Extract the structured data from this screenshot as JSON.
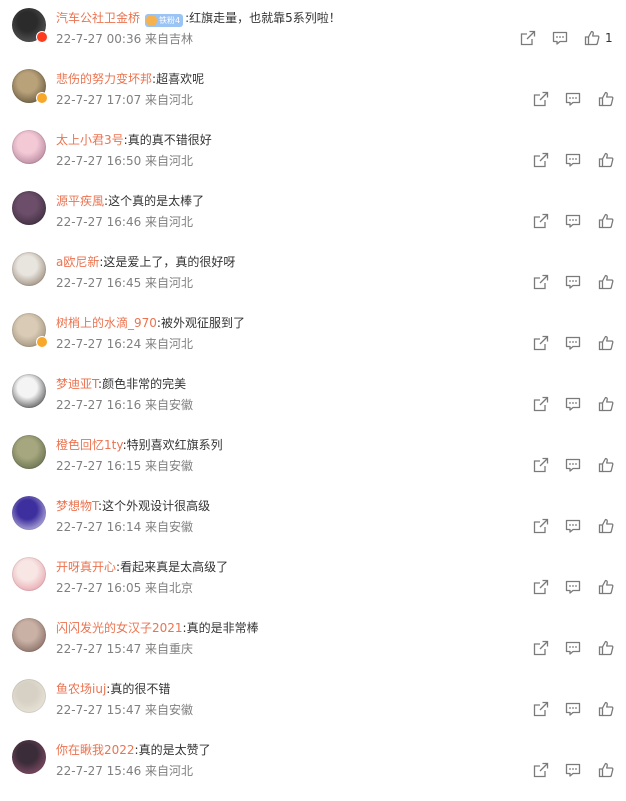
{
  "comments": [
    {
      "user": "汽车公社卫金桥",
      "fan_badge": "铁粉4",
      "text": "红旗走量，也就靠5系列啦！",
      "meta": "22-7-27 00:36 来自吉林",
      "likes": "1",
      "verified": "red",
      "avatar": [
        "#2b2b2b",
        "#6a6a6a"
      ]
    },
    {
      "user": "悲伤的努力变坏邦",
      "text": "超喜欢呢",
      "meta": "22-7-27 17:07 来自河北",
      "verified": "orange",
      "avatar": [
        "#b9a27a",
        "#4a3d2a"
      ]
    },
    {
      "user": "太上小君3号",
      "text": "真的真不错很好",
      "meta": "22-7-27 16:50 来自河北",
      "avatar": [
        "#f3c9d6",
        "#9b6b84"
      ]
    },
    {
      "user": "源平疾風",
      "text": "这个真的是太棒了",
      "meta": "22-7-27 16:46 来自河北",
      "avatar": [
        "#6c4e6a",
        "#2d2230"
      ]
    },
    {
      "user": "a欧尼新",
      "text": "这是爱上了，真的很好呀",
      "meta": "22-7-27 16:45 来自河北",
      "avatar": [
        "#e8e4de",
        "#7e6a56"
      ]
    },
    {
      "user": "树梢上的水滴_970",
      "text": "被外观征服到了",
      "meta": "22-7-27 16:24 来自河北",
      "verified": "orange",
      "avatar": [
        "#d9cbb6",
        "#8a7a64"
      ]
    },
    {
      "user": "梦迪亚T",
      "text": "颜色非常的完美",
      "meta": "22-7-27 16:16 来自安徽",
      "avatar": [
        "#f4f4f4",
        "#1d1d1d"
      ]
    },
    {
      "user": "橙色回忆1ty",
      "text": "特别喜欢红旗系列",
      "meta": "22-7-27 16:15 来自安徽",
      "avatar": [
        "#a6a77e",
        "#4d5a3c"
      ]
    },
    {
      "user": "梦想物T",
      "text": "这个外观设计很高级",
      "meta": "22-7-27 16:14 来自安徽",
      "avatar": [
        "#3e2f9e",
        "#eaeaf7"
      ]
    },
    {
      "user": "开呀真开心",
      "text": "看起来真是太高级了",
      "meta": "22-7-27 16:05 来自北京",
      "avatar": [
        "#f7e6e4",
        "#e28b9a"
      ]
    },
    {
      "user": "闪闪发光的女汉子2021",
      "text": "真的是非常棒",
      "meta": "22-7-27 15:47 来自重庆",
      "avatar": [
        "#c9b1a6",
        "#6e534a"
      ]
    },
    {
      "user": "鱼农场iuj",
      "text": "真的很不错",
      "meta": "22-7-27 15:47 来自安徽",
      "avatar": [
        "#d7d1c5",
        "#f1ece2"
      ]
    },
    {
      "user": "你在瞅我2022",
      "text": "真的是太赞了",
      "meta": "22-7-27 15:46 来自河北",
      "avatar": [
        "#3a2c38",
        "#a05a7a"
      ]
    }
  ],
  "icons": {
    "share": "share-icon",
    "comment": "comment-icon",
    "like": "like-icon"
  },
  "colors": {
    "username": "#eb7350",
    "meta": "#808080",
    "text": "#333333",
    "icon": "#7a7a7a"
  }
}
